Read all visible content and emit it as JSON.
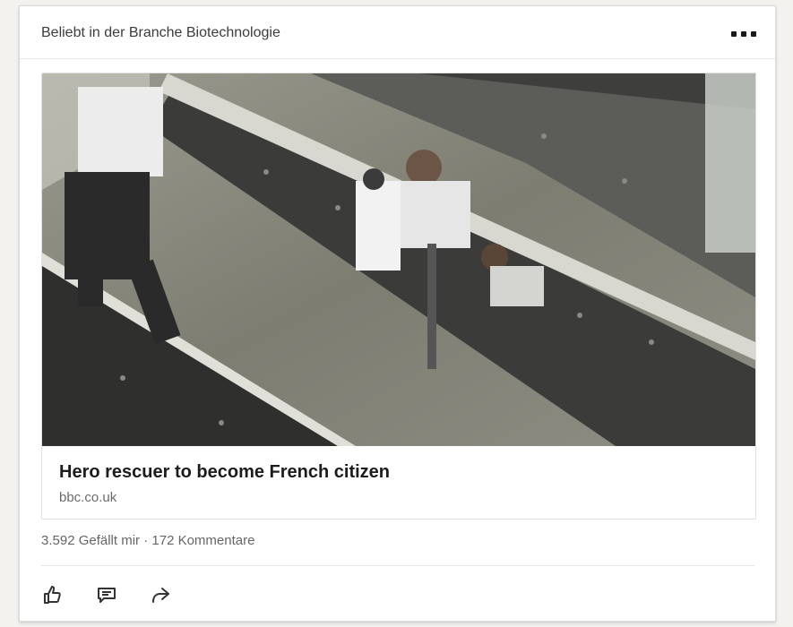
{
  "card": {
    "header_title": "Beliebt in der Branche Biotechnologie",
    "more_icon": "more-dots-icon"
  },
  "article": {
    "title": "Hero rescuer to become French citizen",
    "source": "bbc.co.uk"
  },
  "stats": {
    "likes": "3.592 Gefällt mir",
    "separator": "·",
    "comments": "172 Kommentare"
  },
  "actions": [
    {
      "name": "like-button",
      "icon": "thumbs-up-icon"
    },
    {
      "name": "comment-button",
      "icon": "comment-icon"
    },
    {
      "name": "share-button",
      "icon": "share-arrow-icon"
    }
  ],
  "colors": {
    "background": "#f3f2ef",
    "card": "#ffffff",
    "title": "#1c1c1c",
    "muted": "#666666"
  }
}
